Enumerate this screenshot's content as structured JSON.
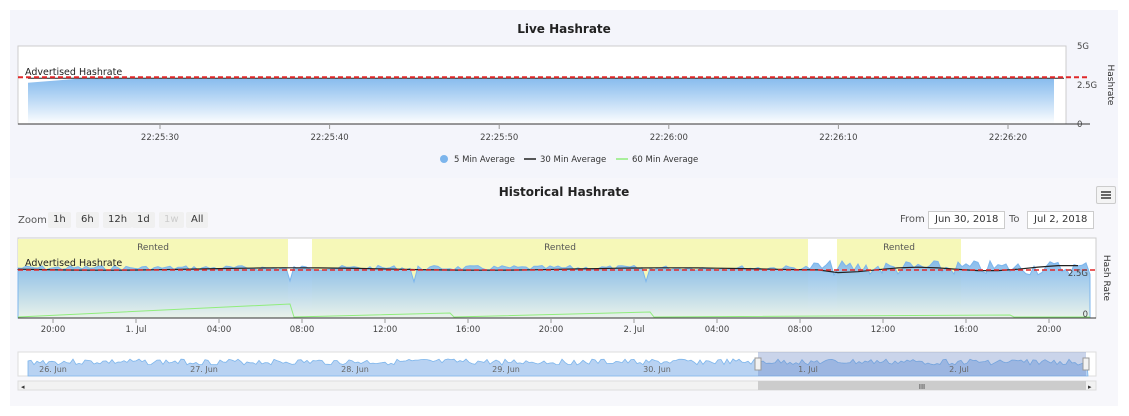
{
  "live": {
    "title": "Live Hashrate",
    "advertised_label": "Advertised Hashrate",
    "ylabel": "Hashrate",
    "y_ticks": [
      "5G",
      "2.5G",
      "0"
    ],
    "x_ticks": [
      "22:25:30",
      "22:25:40",
      "22:25:50",
      "22:26:00",
      "22:26:10",
      "22:26:20"
    ],
    "legend": [
      {
        "label": "5 Min Average",
        "color": "#7cb5ec",
        "shape": "dot"
      },
      {
        "label": "30 Min Average",
        "color": "#222222",
        "shape": "line"
      },
      {
        "label": "60 Min Average",
        "color": "#90ed7d",
        "shape": "line"
      }
    ]
  },
  "historical": {
    "title": "Historical Hashrate",
    "zoom_label": "Zoom",
    "zoom_buttons": [
      "1h",
      "6h",
      "12h",
      "1d",
      "1w",
      "All"
    ],
    "from_label": "From",
    "from_value": "Jun 30, 2018",
    "to_label": "To",
    "to_value": "Jul 2, 2018",
    "advertised_label": "Advertised Hashrate",
    "ylabel": "Hash Rate",
    "y_ticks": [
      "2.5G",
      "0"
    ],
    "x_ticks": [
      "20:00",
      "1. Jul",
      "04:00",
      "08:00",
      "12:00",
      "16:00",
      "20:00",
      "2. Jul",
      "04:00",
      "08:00",
      "12:00",
      "16:00",
      "20:00"
    ],
    "rented_label": "Rented",
    "navigator_ticks": [
      "26. Jun",
      "27. Jun",
      "28. Jun",
      "29. Jun",
      "30. Jun",
      "1. Jul",
      "2. Jul"
    ],
    "navigator_scroll_glyph": "III"
  },
  "colors": {
    "advertised_line": "#e0282a",
    "area_top": "#7cb5ec",
    "area_bottom": "#ffffff",
    "rented_band": "#f6f8b8",
    "line_30min": "#222222",
    "line_60min": "#90ed7d",
    "panel_bg": "#f4f5fb"
  },
  "chart_data": [
    {
      "type": "area",
      "title": "Live Hashrate",
      "xlabel": "",
      "ylabel": "Hashrate",
      "ylim": [
        0,
        5
      ],
      "y_unit": "G",
      "x": [
        "22:25:30",
        "22:25:40",
        "22:25:50",
        "22:26:00",
        "22:26:10",
        "22:26:20"
      ],
      "advertised_hashrate": 3.0,
      "series": [
        {
          "name": "5 Min Average",
          "values": [
            2.9,
            2.9,
            2.9,
            2.9,
            2.9,
            2.9
          ]
        },
        {
          "name": "30 Min Average",
          "values": [
            2.93,
            2.93,
            2.93,
            2.93,
            2.93,
            2.93
          ]
        },
        {
          "name": "60 Min Average",
          "values": [
            2.93,
            2.93,
            2.93,
            2.93,
            2.93,
            2.93
          ]
        }
      ],
      "legend_position": "bottom",
      "grid": true
    },
    {
      "type": "area",
      "title": "Historical Hashrate",
      "xlabel": "",
      "ylabel": "Hash Rate",
      "y_unit": "G",
      "ylim": [
        0,
        5
      ],
      "x_range": [
        "Jun 30, 2018 18:30",
        "Jul 2, 2018 23:00"
      ],
      "advertised_hashrate": 3.0,
      "rented_periods": [
        {
          "label": "Rented",
          "start": "Jun 30 18:00",
          "end": "Jul 1 07:30"
        },
        {
          "label": "Rented",
          "start": "Jul 1 08:30",
          "end": "Jul 2 08:20"
        },
        {
          "label": "Rented",
          "start": "Jul 2 09:30",
          "end": "Jul 2 15:50"
        }
      ],
      "series": [
        {
          "name": "5 Min Average",
          "approx_level": 3.0,
          "min": 0.8,
          "max": 3.9
        },
        {
          "name": "30 Min Average",
          "approx_level": 3.0
        },
        {
          "name": "60 Min Average",
          "approx_level": 0.05,
          "spikes": [
            0.6,
            0.3,
            0.2
          ]
        }
      ],
      "grid": true
    }
  ]
}
